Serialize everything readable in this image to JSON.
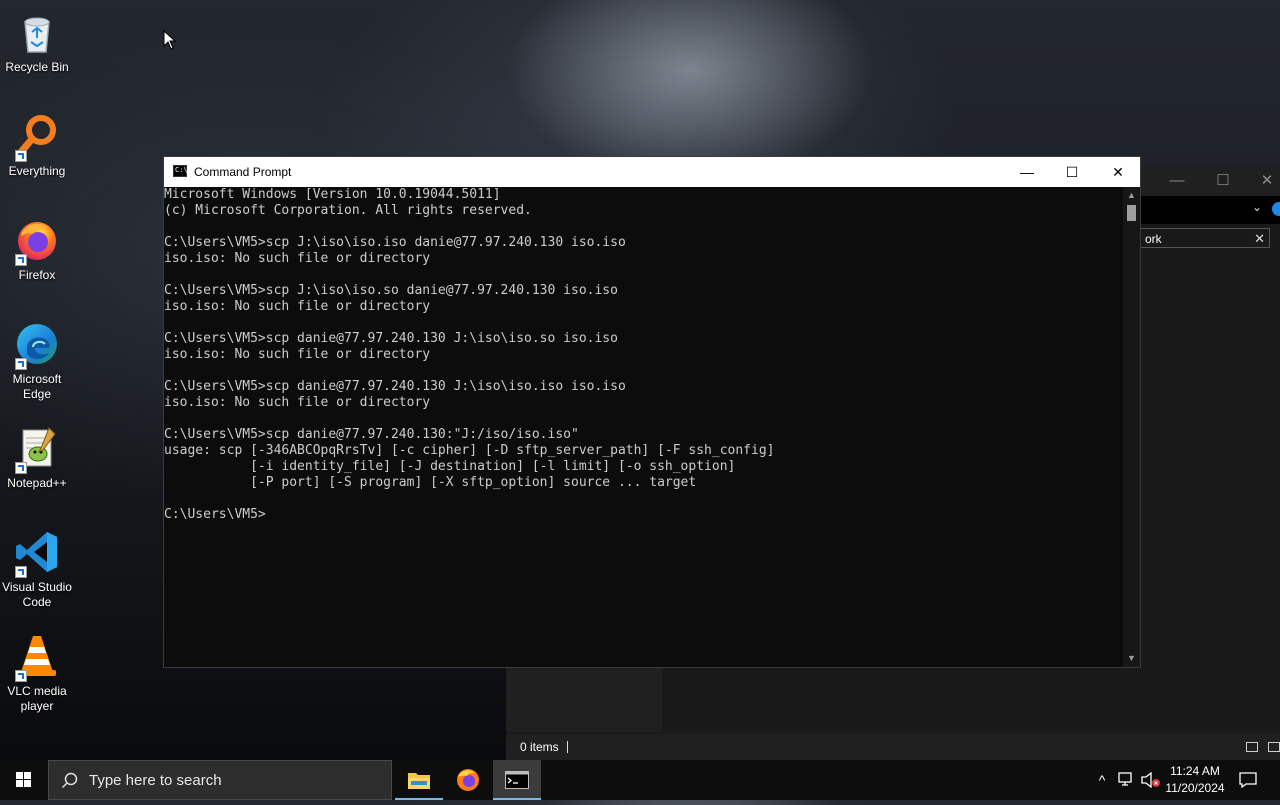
{
  "desktop": {
    "icons": [
      {
        "label": "Recycle Bin",
        "icon": "recycle-bin-icon"
      },
      {
        "label": "Everything",
        "icon": "everything-search-icon"
      },
      {
        "label": "Firefox",
        "icon": "firefox-icon"
      },
      {
        "label": "Microsoft Edge",
        "icon": "edge-icon"
      },
      {
        "label": "Notepad++",
        "icon": "notepadpp-icon"
      },
      {
        "label": "Visual Studio Code",
        "icon": "vscode-icon"
      },
      {
        "label": "VLC media player",
        "icon": "vlc-icon"
      }
    ]
  },
  "cmd": {
    "title": "Command Prompt",
    "icon_glyph": "C:\\",
    "lines": [
      "Microsoft Windows [Version 10.0.19044.5011]",
      "(c) Microsoft Corporation. All rights reserved.",
      "",
      "C:\\Users\\VM5>scp J:\\iso\\iso.iso danie@77.97.240.130 iso.iso",
      "iso.iso: No such file or directory",
      "",
      "C:\\Users\\VM5>scp J:\\iso\\iso.so danie@77.97.240.130 iso.iso",
      "iso.iso: No such file or directory",
      "",
      "C:\\Users\\VM5>scp danie@77.97.240.130 J:\\iso\\iso.so iso.iso",
      "iso.iso: No such file or directory",
      "",
      "C:\\Users\\VM5>scp danie@77.97.240.130 J:\\iso\\iso.iso iso.iso",
      "iso.iso: No such file or directory",
      "",
      "C:\\Users\\VM5>scp danie@77.97.240.130:\"J:/iso/iso.iso\"",
      "usage: scp [-346ABCOpqRrsTv] [-c cipher] [-D sftp_server_path] [-F ssh_config]",
      "           [-i identity_file] [-J destination] [-l limit] [-o ssh_option]",
      "           [-P port] [-S program] [-X sftp_option] source ... target",
      "",
      "C:\\Users\\VM5>"
    ]
  },
  "explorer": {
    "search_partial": "ork",
    "status_items": "0 items"
  },
  "taskbar": {
    "search_placeholder": "Type here to search",
    "apps": [
      "file-explorer",
      "firefox",
      "command-prompt"
    ],
    "active_app": "command-prompt",
    "clock_time": "11:24 AM",
    "clock_date": "11/20/2024"
  },
  "colors": {
    "console_bg": "#0c0c0c",
    "console_text": "#cccccc",
    "taskbar_bg": "#0d0d0d",
    "accent": "#76b9ed"
  }
}
